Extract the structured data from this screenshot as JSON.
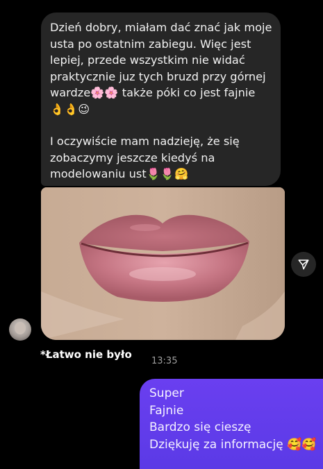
{
  "incoming_message": {
    "paragraph1": "Dzień dobry, miałam dać znać jak moje usta po ostatnim zabiegu. Więc jest lepiej, przede wszystkim nie widać praktycznie juz tych bruzd przy górnej wardze🌸🌸 także póki co jest fajnie 👌👌😉",
    "paragraph2": "I oczywiście mam nadzieję, że się zobaczymy jeszcze kiedyś na modelowaniu ust🌷🌷🤗"
  },
  "photo": {
    "icon": "lips-photo"
  },
  "share_icon": "send-icon",
  "reaction_text": "*Łatwo nie było",
  "timestamp": "13:35",
  "outgoing_message": {
    "lines": [
      "Super",
      "Fajnie",
      "Bardzo się cieszę",
      "Dziękuję za informację 🥰🥰"
    ]
  },
  "colors": {
    "incoming_bg": "#262626",
    "outgoing_bg": "#6a3ff0",
    "background": "#000000"
  }
}
